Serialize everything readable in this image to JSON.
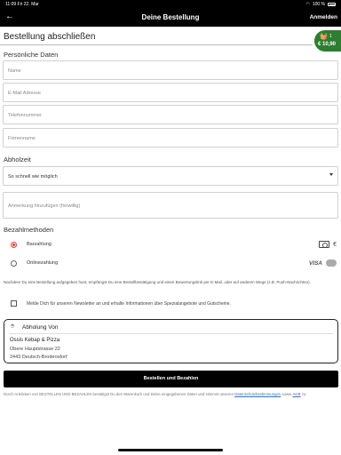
{
  "status_bar": {
    "time": "11:09",
    "date": "Fri 22. Mar",
    "battery": "100 %"
  },
  "header": {
    "back_icon": "arrow-left-icon",
    "title": "Deine Bestellung",
    "login_label": "Anmelden"
  },
  "cart": {
    "count": "1",
    "total": "€ 10,90",
    "icon": "basket-icon",
    "color": "#2e7d32"
  },
  "page_title": "Bestellung abschließen",
  "personal": {
    "heading": "Persönliche Daten",
    "name_placeholder": "Name",
    "email_placeholder": "E-Mail Adresse",
    "phone_placeholder": "Telefonnummer",
    "company_placeholder": "Firmenname"
  },
  "pickup_time": {
    "heading": "Abholzeit",
    "selected": "So schnell wie möglich",
    "note_placeholder": "Anmerkung hinzufügen (freiwillig)"
  },
  "payment": {
    "heading": "Bezahlmethoden",
    "options": [
      {
        "label": "Barzahlung",
        "selected": true,
        "icons": [
          "cash-icon",
          "euro-icon"
        ],
        "euro": "€"
      },
      {
        "label": "Onlinezahlung",
        "selected": false,
        "icons": [
          "visa-icon",
          "card-icon"
        ],
        "visa": "VISA"
      }
    ],
    "accent": "#e53935"
  },
  "info_text": "Nachdem Du eine Bestellung aufgegeben hast, empfängst Du eine Bestellbestätigung und einen Bewertungslink per E-Mail, oder auf anderen Wege (z.B. Push-Nachrichten).",
  "newsletter_label": "Melde Dich für unseren Newsletter an und erhalte Informationen über Spezialangebote und Gutscheine.",
  "pickup_card": {
    "title": "Abholung Von",
    "restaurant": "Ossis Kebap & Pizza",
    "street": "Obere Hauptstrasse 22",
    "city": "2443 Deutsch-Brodersdorf"
  },
  "order_button": "Bestellen und Bezahlen",
  "legal": {
    "prefix": "Durch Anklicken von BESTELLEN UND BEZAHLEN bestätigst Du den Warenkorb und Deine eingegebenen Daten und stimmst unseren",
    "privacy_link": "Datenschutzbestimmungen",
    "middle": "sowie",
    "terms_link": "AGB",
    "suffix": "zu."
  }
}
